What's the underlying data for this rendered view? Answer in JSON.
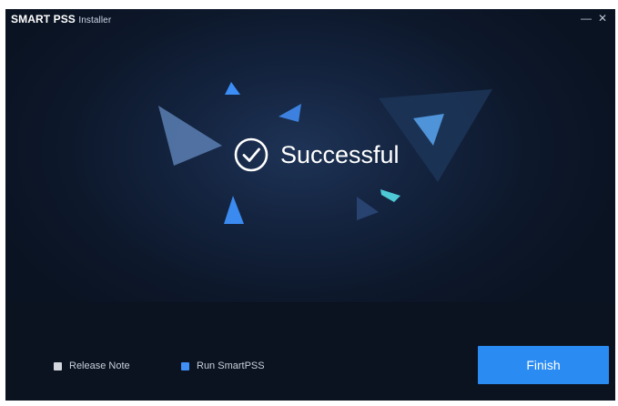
{
  "window": {
    "title_brand": "SMART PSS",
    "title_suffix": "Installer",
    "minimize_glyph": "—",
    "close_glyph": "✕"
  },
  "status": {
    "icon": "check-circle-icon",
    "text": "Successful"
  },
  "footer": {
    "release_note": {
      "label": "Release Note",
      "checked": false
    },
    "run_app": {
      "label": "Run SmartPSS",
      "checked": true
    },
    "finish_label": "Finish"
  },
  "colors": {
    "accent": "#2a8cf3",
    "background": "#0a1322",
    "checkbox_checked": "#3f8ff5"
  }
}
